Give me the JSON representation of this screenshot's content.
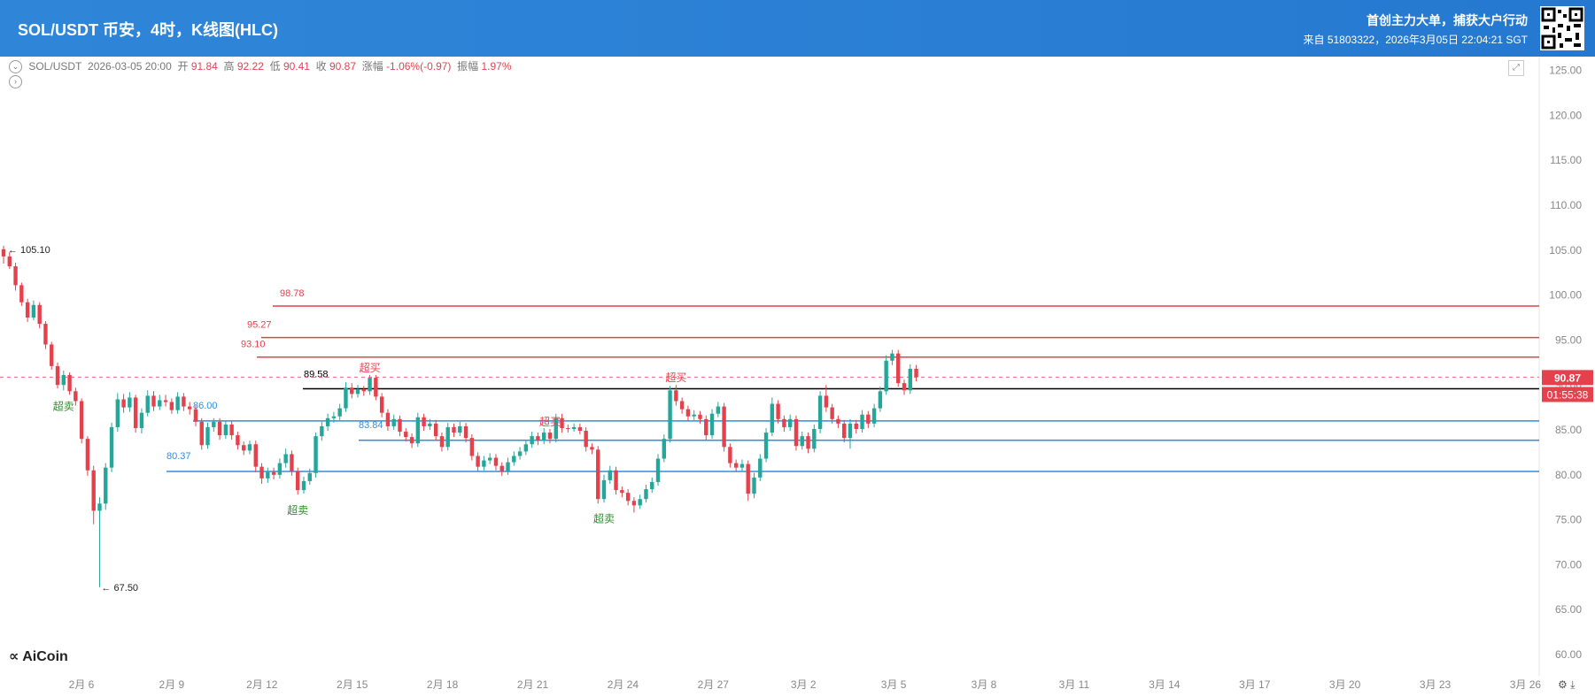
{
  "header": {
    "title": "SOL/USDT 币安，4时，K线图(HLC)",
    "slogan": "首创主力大单，捕获大户行动",
    "source": "来自 51803322，2026年3月05日 22:04:21 SGT"
  },
  "info": {
    "symbol": "SOL/USDT",
    "time": "2026-03-05 20:00",
    "open_label": "开",
    "open": "91.84",
    "high_label": "高",
    "high": "92.22",
    "low_label": "低",
    "low": "90.41",
    "close_label": "收",
    "close": "90.87",
    "change_label": "涨幅",
    "change": "-1.06%(-0.97)",
    "amplitude_label": "振幅",
    "amplitude": "1.97%"
  },
  "logo": "AiCoin",
  "colors": {
    "up": "#26a69a",
    "down": "#e5414d",
    "resistance": "#e5414d",
    "support": "#2f8ee0",
    "accent": "#2a7fd4"
  },
  "chart_data": {
    "type": "candlestick",
    "y_axis": {
      "min": 60,
      "max": 125,
      "ticks": [
        "125.00",
        "120.00",
        "115.00",
        "110.00",
        "105.00",
        "100.00",
        "95.00",
        "90.00",
        "85.00",
        "80.00",
        "75.00",
        "70.00",
        "65.00",
        "60.00"
      ]
    },
    "x_axis": {
      "ticks": [
        "2月 6",
        "2月 9",
        "2月 12",
        "2月 15",
        "2月 18",
        "2月 21",
        "2月 24",
        "2月 27",
        "3月 2",
        "3月 5",
        "3月 8",
        "3月 11",
        "3月 14",
        "3月 17",
        "3月 20",
        "3月 23",
        "3月 26"
      ]
    },
    "candles": [
      [
        105.1,
        104.3,
        105.5,
        103.5
      ],
      [
        104.3,
        103.2,
        104.8,
        102.9
      ],
      [
        103.2,
        101.1,
        103.6,
        100.5
      ],
      [
        101.1,
        99.2,
        101.4,
        98.8
      ],
      [
        99.2,
        97.5,
        99.6,
        97.0
      ],
      [
        97.5,
        98.9,
        99.4,
        97.2
      ],
      [
        98.9,
        96.8,
        99.2,
        96.3
      ],
      [
        96.8,
        94.5,
        97.1,
        94.0
      ],
      [
        94.5,
        92.1,
        94.8,
        91.7
      ],
      [
        92.1,
        90.0,
        92.5,
        89.6
      ],
      [
        90.0,
        91.1,
        91.6,
        89.4
      ],
      [
        91.1,
        89.3,
        91.4,
        88.9
      ],
      [
        89.3,
        88.2,
        89.7,
        87.7
      ],
      [
        88.2,
        84.0,
        88.5,
        83.5
      ],
      [
        84.0,
        80.5,
        84.3,
        79.9
      ],
      [
        80.5,
        76.0,
        81.0,
        74.5
      ],
      [
        76.0,
        76.8,
        77.5,
        67.5
      ],
      [
        76.8,
        80.8,
        81.3,
        76.1
      ],
      [
        80.8,
        85.3,
        85.8,
        80.3
      ],
      [
        85.3,
        88.4,
        89.1,
        84.8
      ],
      [
        88.4,
        87.5,
        89.0,
        86.9
      ],
      [
        87.5,
        88.6,
        89.2,
        87.0
      ],
      [
        88.6,
        85.2,
        88.9,
        84.7
      ],
      [
        85.2,
        86.9,
        87.4,
        84.6
      ],
      [
        86.9,
        88.8,
        89.4,
        86.5
      ],
      [
        88.8,
        87.6,
        89.3,
        87.1
      ],
      [
        87.6,
        88.3,
        88.9,
        87.2
      ],
      [
        88.3,
        88.1,
        88.9,
        87.6
      ],
      [
        88.1,
        87.2,
        88.5,
        86.8
      ],
      [
        87.2,
        88.7,
        89.2,
        86.8
      ],
      [
        88.7,
        87.6,
        89.1,
        87.1
      ],
      [
        87.6,
        87.3,
        88.1,
        86.7
      ],
      [
        87.3,
        85.9,
        87.7,
        85.4
      ],
      [
        85.9,
        83.3,
        86.3,
        82.8
      ],
      [
        83.3,
        85.3,
        85.8,
        82.9
      ],
      [
        85.3,
        85.9,
        86.3,
        84.8
      ],
      [
        85.9,
        84.4,
        86.3,
        83.9
      ],
      [
        84.4,
        85.6,
        86.0,
        84.0
      ],
      [
        85.6,
        84.4,
        86.0,
        83.9
      ],
      [
        84.4,
        83.3,
        84.8,
        82.8
      ],
      [
        83.3,
        82.7,
        83.7,
        82.2
      ],
      [
        82.7,
        83.4,
        83.8,
        82.3
      ],
      [
        83.4,
        80.9,
        83.8,
        80.3
      ],
      [
        80.9,
        79.6,
        81.3,
        79.0
      ],
      [
        79.6,
        80.3,
        80.8,
        79.1
      ],
      [
        80.3,
        80.0,
        80.8,
        79.5
      ],
      [
        80.0,
        81.3,
        81.8,
        79.6
      ],
      [
        81.3,
        82.3,
        82.9,
        80.8
      ],
      [
        82.3,
        80.4,
        82.7,
        79.9
      ],
      [
        80.4,
        78.3,
        80.8,
        77.8
      ],
      [
        78.3,
        79.3,
        79.8,
        77.9
      ],
      [
        79.3,
        80.2,
        80.7,
        78.9
      ],
      [
        80.2,
        84.3,
        84.7,
        79.7
      ],
      [
        84.3,
        85.4,
        85.9,
        83.8
      ],
      [
        85.4,
        86.3,
        86.8,
        84.9
      ],
      [
        86.3,
        86.5,
        87.0,
        85.8
      ],
      [
        86.5,
        87.4,
        87.9,
        86.1
      ],
      [
        87.4,
        89.7,
        90.3,
        87.0
      ],
      [
        89.7,
        89.0,
        90.2,
        88.5
      ],
      [
        89.0,
        89.5,
        90.0,
        88.6
      ],
      [
        89.5,
        89.3,
        89.9,
        88.8
      ],
      [
        89.3,
        90.8,
        91.1,
        88.9
      ],
      [
        90.8,
        88.7,
        91.1,
        88.3
      ],
      [
        88.7,
        86.9,
        89.1,
        86.4
      ],
      [
        86.9,
        85.4,
        87.3,
        84.9
      ],
      [
        85.4,
        86.2,
        86.7,
        85.0
      ],
      [
        86.2,
        84.8,
        86.6,
        84.3
      ],
      [
        84.8,
        84.2,
        85.2,
        83.7
      ],
      [
        84.2,
        83.5,
        84.6,
        83.0
      ],
      [
        83.5,
        86.4,
        86.9,
        83.1
      ],
      [
        86.4,
        85.4,
        86.8,
        84.9
      ],
      [
        85.4,
        85.7,
        86.2,
        85.0
      ],
      [
        85.7,
        84.3,
        86.1,
        83.8
      ],
      [
        84.3,
        83.1,
        84.7,
        82.6
      ],
      [
        83.1,
        85.3,
        85.8,
        82.7
      ],
      [
        85.3,
        84.7,
        85.7,
        84.2
      ],
      [
        84.7,
        85.4,
        85.9,
        84.3
      ],
      [
        85.4,
        84.1,
        85.8,
        83.6
      ],
      [
        84.1,
        82.1,
        84.5,
        81.6
      ],
      [
        82.1,
        80.9,
        82.5,
        80.4
      ],
      [
        80.9,
        81.6,
        82.1,
        80.5
      ],
      [
        81.6,
        81.9,
        82.4,
        81.2
      ],
      [
        81.9,
        81.0,
        82.3,
        80.5
      ],
      [
        81.0,
        80.4,
        81.4,
        79.9
      ],
      [
        80.4,
        81.4,
        81.9,
        80.0
      ],
      [
        81.4,
        82.1,
        82.6,
        81.0
      ],
      [
        82.1,
        82.6,
        83.1,
        81.7
      ],
      [
        82.6,
        83.4,
        83.9,
        82.2
      ],
      [
        83.4,
        84.3,
        84.8,
        83.0
      ],
      [
        84.3,
        83.8,
        84.7,
        83.3
      ],
      [
        83.8,
        84.7,
        85.2,
        83.4
      ],
      [
        84.7,
        84.0,
        85.1,
        83.5
      ],
      [
        84.0,
        86.3,
        86.8,
        83.6
      ],
      [
        86.3,
        85.2,
        86.8,
        84.7
      ],
      [
        85.2,
        85.1,
        85.6,
        84.7
      ],
      [
        85.1,
        85.3,
        85.7,
        84.8
      ],
      [
        85.3,
        84.9,
        85.7,
        84.5
      ],
      [
        84.9,
        83.1,
        85.3,
        82.6
      ],
      [
        83.1,
        82.8,
        83.5,
        82.3
      ],
      [
        82.8,
        77.3,
        83.2,
        76.8
      ],
      [
        77.3,
        79.4,
        80.0,
        76.9
      ],
      [
        79.4,
        80.5,
        81.0,
        79.0
      ],
      [
        80.5,
        78.3,
        80.9,
        77.8
      ],
      [
        78.3,
        78.0,
        78.7,
        77.5
      ],
      [
        78.0,
        77.1,
        78.4,
        76.6
      ],
      [
        77.1,
        76.6,
        77.5,
        75.8
      ],
      [
        76.6,
        77.3,
        77.8,
        76.2
      ],
      [
        77.3,
        78.4,
        78.9,
        76.9
      ],
      [
        78.4,
        79.2,
        79.7,
        78.0
      ],
      [
        79.2,
        81.8,
        82.3,
        78.8
      ],
      [
        81.8,
        84.0,
        84.5,
        81.4
      ],
      [
        84.0,
        89.4,
        89.9,
        83.6
      ],
      [
        89.4,
        88.2,
        90.0,
        87.7
      ],
      [
        88.2,
        87.3,
        88.6,
        86.8
      ],
      [
        87.3,
        86.5,
        87.7,
        86.0
      ],
      [
        86.5,
        86.7,
        87.2,
        86.1
      ],
      [
        86.7,
        86.2,
        87.1,
        85.7
      ],
      [
        86.2,
        84.4,
        86.6,
        83.9
      ],
      [
        84.4,
        86.8,
        87.3,
        84.0
      ],
      [
        86.8,
        87.6,
        88.1,
        86.4
      ],
      [
        87.6,
        83.1,
        88.0,
        82.6
      ],
      [
        83.1,
        81.3,
        83.5,
        80.8
      ],
      [
        81.3,
        80.8,
        81.7,
        80.3
      ],
      [
        80.8,
        81.2,
        81.7,
        80.4
      ],
      [
        81.2,
        77.9,
        81.6,
        77.1
      ],
      [
        77.9,
        79.7,
        80.2,
        77.4
      ],
      [
        79.7,
        81.8,
        82.3,
        79.3
      ],
      [
        81.8,
        84.7,
        85.2,
        81.4
      ],
      [
        84.7,
        87.9,
        88.6,
        84.3
      ],
      [
        87.9,
        86.2,
        88.3,
        85.7
      ],
      [
        86.2,
        85.3,
        86.6,
        84.8
      ],
      [
        85.3,
        86.2,
        86.7,
        84.9
      ],
      [
        86.2,
        83.2,
        86.6,
        82.7
      ],
      [
        83.2,
        84.3,
        84.8,
        82.8
      ],
      [
        84.3,
        82.9,
        84.7,
        82.4
      ],
      [
        82.9,
        85.1,
        85.6,
        82.5
      ],
      [
        85.1,
        88.8,
        89.3,
        84.6
      ],
      [
        88.8,
        87.5,
        90.0,
        87.0
      ],
      [
        87.5,
        86.2,
        87.9,
        85.7
      ],
      [
        86.2,
        85.7,
        86.6,
        85.2
      ],
      [
        85.7,
        84.1,
        86.1,
        83.6
      ],
      [
        84.1,
        85.7,
        86.2,
        82.9
      ],
      [
        85.7,
        85.1,
        86.1,
        84.6
      ],
      [
        85.1,
        86.7,
        87.2,
        84.7
      ],
      [
        86.7,
        85.7,
        87.1,
        85.2
      ],
      [
        85.7,
        87.4,
        87.9,
        85.3
      ],
      [
        87.4,
        89.3,
        89.8,
        87.0
      ],
      [
        89.3,
        92.7,
        93.3,
        88.9
      ],
      [
        92.7,
        93.5,
        93.9,
        92.2
      ],
      [
        93.5,
        90.2,
        93.9,
        89.8
      ],
      [
        90.2,
        89.4,
        90.6,
        88.9
      ],
      [
        89.4,
        91.8,
        92.3,
        89.0
      ],
      [
        91.8,
        90.87,
        92.22,
        90.41
      ]
    ],
    "current_price": "90.87",
    "countdown": "01:55:38",
    "high_marker": "105.10",
    "low_marker": "67.50",
    "resistance_lines": [
      {
        "price": 98.78,
        "label": "98.78"
      },
      {
        "price": 95.27,
        "label": "95.27"
      },
      {
        "price": 93.1,
        "label": "93.10"
      }
    ],
    "key_line": {
      "price": 89.58,
      "label": "89.58"
    },
    "support_lines": [
      {
        "price": 86.0,
        "label": "86.00"
      },
      {
        "price": 83.84,
        "label": "83.84"
      },
      {
        "price": 80.37,
        "label": "80.37"
      }
    ],
    "signals": [
      {
        "text": "超卖",
        "candle": 10,
        "kind": "sell"
      },
      {
        "text": "超卖",
        "candle": 49,
        "kind": "sell"
      },
      {
        "text": "超买",
        "candle": 61,
        "kind": "buy"
      },
      {
        "text": "超买",
        "candle": 91,
        "kind": "buy"
      },
      {
        "text": "超卖",
        "candle": 100,
        "kind": "sell"
      },
      {
        "text": "超买",
        "candle": 112,
        "kind": "buy"
      }
    ]
  }
}
